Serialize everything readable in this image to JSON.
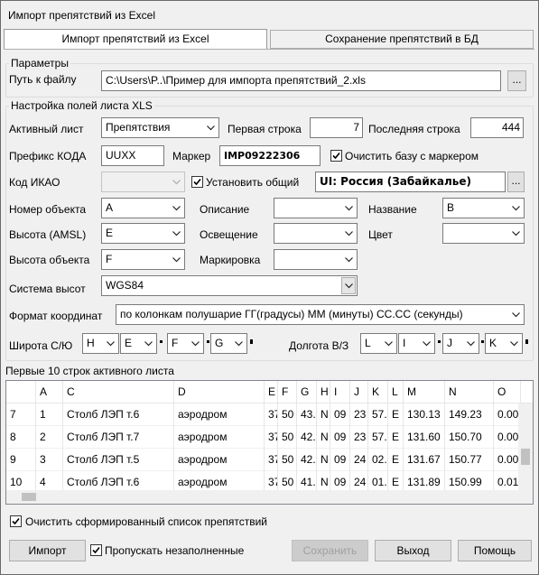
{
  "window": {
    "title": "Импорт препятствий из Excel"
  },
  "tabs": [
    {
      "label": "Импорт препятствий из Excel",
      "active": true
    },
    {
      "label": "Сохранение препятствий в БД",
      "active": false
    }
  ],
  "params": {
    "group_label": "Параметры",
    "path_label": "Путь к файлу",
    "path_value": "C:\\Users\\P..\\Пример для импорта препятствий_2.xls",
    "browse_label": "..."
  },
  "xls": {
    "group_label": "Настройка полей листа XLS",
    "active_sheet_label": "Активный лист",
    "active_sheet_value": "Препятствия",
    "first_row_label": "Первая строка",
    "first_row_value": "7",
    "last_row_label": "Последняя строка",
    "last_row_value": "444",
    "prefix_label": "Префикс КОДА",
    "prefix_value": "UUXX",
    "marker_label": "Маркер",
    "marker_value": "IMP09222306",
    "clear_base_label": "Очистить базу с маркером",
    "icao_label": "Код ИКАО",
    "icao_value": "",
    "set_common_label": "Установить общий",
    "region_value": "UI: Россия (Забайкалье)",
    "region_btn": "...",
    "obj_num_label": "Номер объекта",
    "obj_num_value": "A",
    "desc_label": "Описание",
    "desc_value": "",
    "name_label": "Название",
    "name_value": "B",
    "height_amsl_label": "Высота (AMSL)",
    "height_amsl_value": "E",
    "lighting_label": "Освещение",
    "lighting_value": "",
    "color_label": "Цвет",
    "color_value": "",
    "obj_height_label": "Высота объекта",
    "obj_height_value": "F",
    "marking_label": "Маркировка",
    "marking_value": "",
    "height_sys_label": "Система высот",
    "height_sys_value": "WGS84",
    "coord_format_label": "Формат координат",
    "coord_format_value": "по колонкам полушарие ГГ(градусы)  ММ (минуты) СС.СС (секунды)",
    "lat_label": "Широта С/Ю",
    "lat_cols": [
      "H",
      "E",
      "F",
      "G"
    ],
    "lon_label": "Долгота В/З",
    "lon_cols": [
      "L",
      "I",
      "J",
      "K"
    ]
  },
  "preview": {
    "label": "Первые 10 строк активного листа",
    "columns": [
      "",
      "A",
      "C",
      "D",
      "E",
      "F",
      "G",
      "H",
      "I",
      "J",
      "K",
      "L",
      "M",
      "N",
      "O"
    ],
    "rows": [
      [
        "7",
        "1",
        "Столб ЛЭП т.6",
        "аэродром",
        "37",
        "50",
        "43.",
        "N",
        "09",
        "23",
        "57.",
        "E",
        "130.13",
        "149.23",
        "0.00"
      ],
      [
        "8",
        "2",
        "Столб ЛЭП т.7",
        "аэродром",
        "37",
        "50",
        "42.",
        "N",
        "09",
        "23",
        "57.",
        "E",
        "131.60",
        "150.70",
        "0.00"
      ],
      [
        "9",
        "3",
        "Столб ЛЭП т.5",
        "аэродром",
        "37",
        "50",
        "42.",
        "N",
        "09",
        "24",
        "02.",
        "E",
        "131.67",
        "150.77",
        "0.00"
      ],
      [
        "10",
        "4",
        "Столб ЛЭП т.6",
        "аэродром",
        "37",
        "50",
        "41.",
        "N",
        "09",
        "24",
        "01.",
        "E",
        "131.89",
        "150.99",
        "0.01"
      ]
    ]
  },
  "bottom": {
    "clear_list_label": "Очистить сформированный список препятствий",
    "import_label": "Импорт",
    "skip_empty_label": "Пропускать незаполненные",
    "save_label": "Сохранить",
    "exit_label": "Выход",
    "help_label": "Помощь"
  }
}
